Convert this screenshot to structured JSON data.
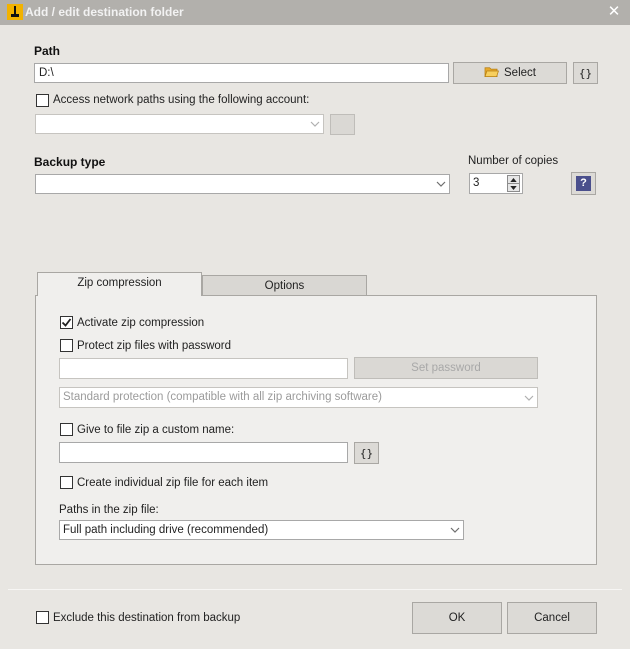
{
  "window": {
    "title": "Add / edit destination folder",
    "close_glyph": "✕"
  },
  "path": {
    "label": "Path",
    "value": "D:\\",
    "select_label": "Select",
    "vars_label": "{}"
  },
  "network": {
    "label": "Access network paths using the following account:",
    "checked": false,
    "account_value": ""
  },
  "backup_type": {
    "label": "Backup type",
    "value": ""
  },
  "copies": {
    "label": "Number of copies",
    "value": "3",
    "help_label": "?"
  },
  "tabs": [
    {
      "label": "Zip compression",
      "active": true
    },
    {
      "label": "Options",
      "active": false
    }
  ],
  "zip": {
    "activate_label": "Activate zip compression",
    "activate_checked": true,
    "protect_label": "Protect zip files with password",
    "protect_checked": false,
    "password_value": "",
    "set_password_label": "Set password",
    "protection_value": "Standard protection (compatible with all zip archiving software)",
    "custom_name_label": "Give to file zip a custom name:",
    "custom_name_checked": false,
    "custom_name_value": "",
    "custom_vars_label": "{}",
    "individual_label": "Create individual zip file for each item",
    "individual_checked": false,
    "paths_label": "Paths in the zip file:",
    "paths_value": "Full path including drive (recommended)"
  },
  "footer": {
    "exclude_label": "Exclude this destination from backup",
    "exclude_checked": false,
    "ok_label": "OK",
    "cancel_label": "Cancel"
  },
  "colors": {
    "titlebar": "#b2b0ac",
    "dialog_bg": "#e8e6e2",
    "tab_panel_bg": "#f0efed",
    "help_button": "#4a4f8c",
    "app_icon_yellow": "#f2b200"
  }
}
